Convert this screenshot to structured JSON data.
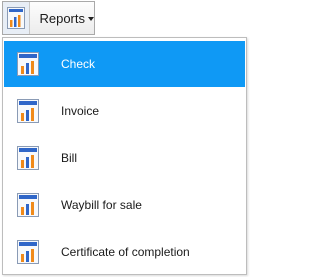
{
  "toolbar": {
    "reports_label": "Reports"
  },
  "menu": {
    "items": [
      {
        "label": "Check",
        "selected": true
      },
      {
        "label": "Invoice",
        "selected": false
      },
      {
        "label": "Bill",
        "selected": false
      },
      {
        "label": "Waybill for sale",
        "selected": false
      },
      {
        "label": "Certificate of completion",
        "selected": false
      }
    ]
  },
  "colors": {
    "selection": "#0f99f5",
    "icon_orange": "#f08a1a",
    "icon_blue": "#2f66c8"
  }
}
